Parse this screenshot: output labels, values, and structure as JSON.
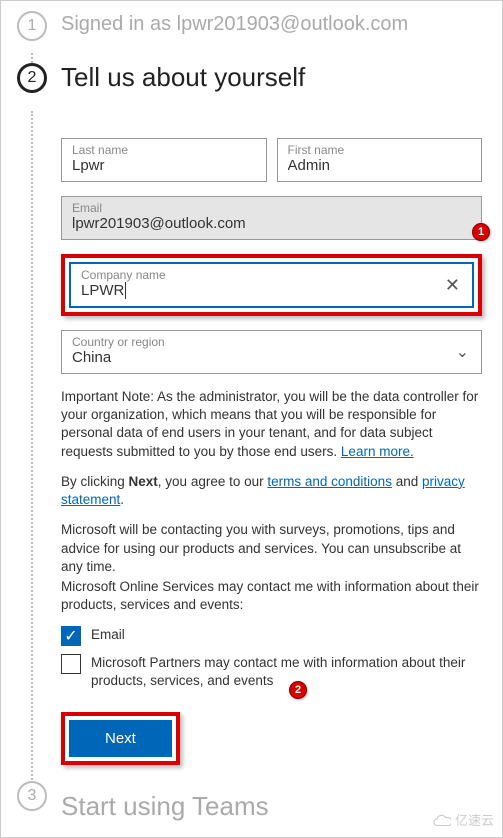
{
  "steps": {
    "s1": {
      "num": "1",
      "title": "Signed in as lpwr201903@outlook.com"
    },
    "s2": {
      "num": "2",
      "title": "Tell us about yourself"
    },
    "s3": {
      "num": "3",
      "title": "Start using Teams"
    }
  },
  "fields": {
    "lastName": {
      "label": "Last name",
      "value": "Lpwr"
    },
    "firstName": {
      "label": "First name",
      "value": "Admin"
    },
    "email": {
      "label": "Email",
      "value": "lpwr201903@outlook.com"
    },
    "company": {
      "label": "Company name",
      "value": "LPWR"
    },
    "country": {
      "label": "Country or region",
      "value": "China"
    }
  },
  "notes": {
    "important_prefix": "Important Note: As the administrator, you will be the data controller for your organization, which means that you will be responsible for personal data of end users in your tenant, and for data subject requests submitted to you by those end users. ",
    "learn_more": "Learn more.",
    "agree_prefix": "By clicking ",
    "agree_bold": "Next",
    "agree_mid": ", you agree to our ",
    "terms": "terms and conditions",
    "agree_and": " and ",
    "privacy": "privacy statement",
    "agree_suffix": ".",
    "contact1": "Microsoft will be contacting you with surveys, promotions, tips and advice for using our products and services. You can unsubscribe at any time.",
    "contact2": "Microsoft Online Services may contact me with information about their products, services and events:"
  },
  "checkboxes": {
    "email": {
      "label": "Email",
      "checked": true
    },
    "partners": {
      "label": "Microsoft Partners may contact me with information about their products, services, and events",
      "checked": false
    }
  },
  "buttons": {
    "next": "Next"
  },
  "badges": {
    "b1": "1",
    "b2": "2"
  },
  "watermark": "亿速云",
  "icons": {
    "check": "✓",
    "clear": "✕",
    "chevron": "⌄"
  }
}
